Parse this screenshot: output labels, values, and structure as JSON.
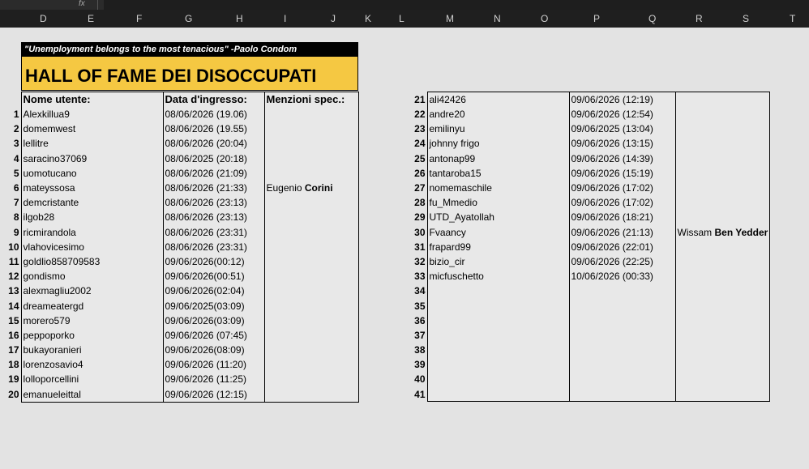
{
  "formula_bar": {
    "fx": "fx"
  },
  "columns": [
    "D",
    "E",
    "F",
    "G",
    "H",
    "I",
    "J",
    "K",
    "L",
    "M",
    "N",
    "O",
    "P",
    "Q",
    "R",
    "S",
    "T"
  ],
  "quote": "\"Unemployment belongs to the most tenacious\" -Paolo Condom",
  "title": "HALL OF FAME DEI DISOCCUPATI",
  "left_table": {
    "headers": {
      "user": "Nome utente:",
      "date": "Data d'ingresso:",
      "mentions": "Menzioni spec.:"
    },
    "rows": [
      {
        "n": "1",
        "user": "Alexkillua9",
        "date": "08/06/2026 (19.06)",
        "mention_first": "",
        "mention_last": ""
      },
      {
        "n": "2",
        "user": "domemwest",
        "date": "08/06/2026 (19.55)",
        "mention_first": "",
        "mention_last": ""
      },
      {
        "n": "3",
        "user": "lellitre",
        "date": "08/06/2026 (20:04)",
        "mention_first": "",
        "mention_last": ""
      },
      {
        "n": "4",
        "user": "saracino37069",
        "date": "08/06/2025 (20:18)",
        "mention_first": "",
        "mention_last": ""
      },
      {
        "n": "5",
        "user": "uomotucano",
        "date": "08/06/2026 (21:09)",
        "mention_first": "",
        "mention_last": ""
      },
      {
        "n": "6",
        "user": "mateyssosa",
        "date": "08/06/2026 (21:33)",
        "mention_first": "Eugenio ",
        "mention_last": "Corini"
      },
      {
        "n": "7",
        "user": "demcristante",
        "date": "08/06/2026 (23:13)",
        "mention_first": "",
        "mention_last": ""
      },
      {
        "n": "8",
        "user": "ilgob28",
        "date": "08/06/2026 (23:13)",
        "mention_first": "",
        "mention_last": ""
      },
      {
        "n": "9",
        "user": "ricmirandola",
        "date": "08/06/2026 (23:31)",
        "mention_first": "",
        "mention_last": ""
      },
      {
        "n": "10",
        "user": "vlahovicesimo",
        "date": "08/06/2026 (23:31)",
        "mention_first": "",
        "mention_last": ""
      },
      {
        "n": "11",
        "user": "goldlio858709583",
        "date": "09/06/2026(00:12)",
        "mention_first": "",
        "mention_last": ""
      },
      {
        "n": "12",
        "user": "gondismo",
        "date": "09/06/2026(00:51)",
        "mention_first": "",
        "mention_last": ""
      },
      {
        "n": "13",
        "user": "alexmagliu2002",
        "date": "09/06/2026(02:04)",
        "mention_first": "",
        "mention_last": ""
      },
      {
        "n": "14",
        "user": "dreameatergd",
        "date": "09/06/2025(03:09)",
        "mention_first": "",
        "mention_last": ""
      },
      {
        "n": "15",
        "user": "morero579",
        "date": "09/06/2026(03:09)",
        "mention_first": "",
        "mention_last": ""
      },
      {
        "n": "16",
        "user": "peppoporko",
        "date": "09/06/2026 (07:45)",
        "mention_first": "",
        "mention_last": ""
      },
      {
        "n": "17",
        "user": "bukayoranieri",
        "date": "09/06/2026(08:09)",
        "mention_first": "",
        "mention_last": ""
      },
      {
        "n": "18",
        "user": "lorenzosavio4",
        "date": "09/06/2026 (11:20)",
        "mention_first": "",
        "mention_last": ""
      },
      {
        "n": "19",
        "user": "lolloporcellini",
        "date": "09/06/2026 (11:25)",
        "mention_first": "",
        "mention_last": ""
      },
      {
        "n": "20",
        "user": "emanueleittal",
        "date": "09/06/2026 (12:15)",
        "mention_first": "",
        "mention_last": ""
      }
    ]
  },
  "right_table": {
    "rows": [
      {
        "n": "21",
        "user": "ali42426",
        "date": "09/06/2026 (12:19)",
        "mention_first": "",
        "mention_last": ""
      },
      {
        "n": "22",
        "user": "andre20",
        "date": "09/06/2026 (12:54)",
        "mention_first": "",
        "mention_last": ""
      },
      {
        "n": "23",
        "user": "emilinyu",
        "date": "09/06/2025 (13:04)",
        "mention_first": "",
        "mention_last": ""
      },
      {
        "n": "24",
        "user": "johnny frigo",
        "date": "09/06/2026 (13:15)",
        "mention_first": "",
        "mention_last": ""
      },
      {
        "n": "25",
        "user": "antonap99",
        "date": "09/06/2026 (14:39)",
        "mention_first": "",
        "mention_last": ""
      },
      {
        "n": "26",
        "user": "tantaroba15",
        "date": "09/06/2026 (15:19)",
        "mention_first": "",
        "mention_last": ""
      },
      {
        "n": "27",
        "user": "nomemaschile",
        "date": "09/06/2026 (17:02)",
        "mention_first": "",
        "mention_last": ""
      },
      {
        "n": "28",
        "user": "fu_Mmedio",
        "date": "09/06/2026 (17:02)",
        "mention_first": "",
        "mention_last": ""
      },
      {
        "n": "29",
        "user": "UTD_Ayatollah",
        "date": "09/06/2026 (18:21)",
        "mention_first": "",
        "mention_last": ""
      },
      {
        "n": "30",
        "user": "Fvaancy",
        "date": "09/06/2026 (21:13)",
        "mention_first": "Wissam ",
        "mention_last": "Ben Yedder"
      },
      {
        "n": "31",
        "user": "frapard99",
        "date": "09/06/2026 (22:01)",
        "mention_first": "",
        "mention_last": ""
      },
      {
        "n": "32",
        "user": "bizio_cir",
        "date": "09/06/2026 (22:25)",
        "mention_first": "",
        "mention_last": ""
      },
      {
        "n": "33",
        "user": "micfuschetto",
        "date": "10/06/2026 (00:33)",
        "mention_first": "",
        "mention_last": ""
      },
      {
        "n": "34",
        "user": "",
        "date": "",
        "mention_first": "",
        "mention_last": ""
      },
      {
        "n": "35",
        "user": "",
        "date": "",
        "mention_first": "",
        "mention_last": ""
      },
      {
        "n": "36",
        "user": "",
        "date": "",
        "mention_first": "",
        "mention_last": ""
      },
      {
        "n": "37",
        "user": "",
        "date": "",
        "mention_first": "",
        "mention_last": ""
      },
      {
        "n": "38",
        "user": "",
        "date": "",
        "mention_first": "",
        "mention_last": ""
      },
      {
        "n": "39",
        "user": "",
        "date": "",
        "mention_first": "",
        "mention_last": ""
      },
      {
        "n": "40",
        "user": "",
        "date": "",
        "mention_first": "",
        "mention_last": ""
      },
      {
        "n": "41",
        "user": "",
        "date": "",
        "mention_first": "",
        "mention_last": ""
      }
    ]
  },
  "colors": {
    "title_bg": "#f5c842",
    "quote_bg": "#000000",
    "cell_bg": "#e8e8e8",
    "header_bg": "#1f1f1f"
  }
}
